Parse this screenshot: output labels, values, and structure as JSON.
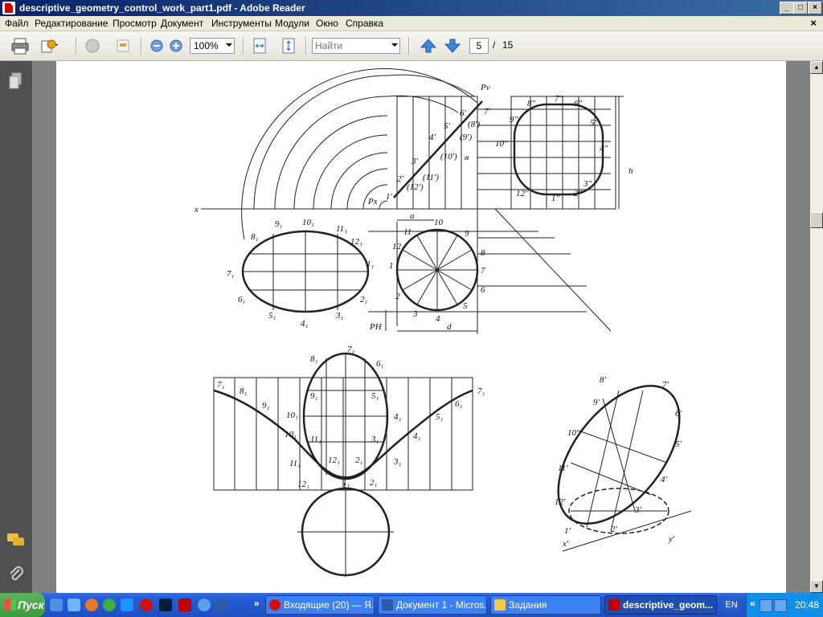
{
  "window": {
    "title": "descriptive_geometry_control_work_part1.pdf - Adobe Reader",
    "controls": {
      "minimize": "_",
      "maximize": "□",
      "close": "×"
    }
  },
  "menu": {
    "items": [
      "Файл",
      "Редактирование",
      "Просмотр",
      "Документ",
      "Инструменты",
      "Модули",
      "Окно",
      "Справка"
    ],
    "close_document": "×"
  },
  "toolbar": {
    "zoom_value": "100%",
    "find_placeholder": "Найти",
    "current_page": "5",
    "page_separator": "/",
    "total_pages": "15"
  },
  "drawing": {
    "top_labels": {
      "pv": "Pv",
      "px": "Px",
      "ph": "PH",
      "x": "x",
      "a": "a",
      "d": "d",
      "h": "h",
      "alpha": "∝",
      "front_points": [
        "1'",
        "2'",
        "3'",
        "4'",
        "5'",
        "6'",
        "7'",
        "(8')",
        "(9')",
        "(10')",
        "(11')",
        "(12')"
      ],
      "side_points": [
        "8''",
        "7''",
        "6''",
        "9''",
        "5''",
        "10''",
        "4''",
        "3''",
        "12''",
        "1''",
        "2''"
      ],
      "top_view_numbers": [
        "10",
        "11",
        "9",
        "12",
        "8",
        "1",
        "7",
        "2",
        "6",
        "3",
        "4",
        "5"
      ],
      "section_labels": [
        "10₁",
        "9₁",
        "11₁",
        "8₁",
        "12₁",
        "7₁",
        "1₁",
        "6₁",
        "2₁",
        "5₁",
        "4₁",
        "3₁"
      ]
    },
    "development_labels": [
      "7₁",
      "8₁",
      "9₁",
      "10₁",
      "11₁",
      "12₁",
      "1₁",
      "2₁",
      "3₁",
      "4₁",
      "5₁",
      "6₁",
      "7₁"
    ],
    "ellipse_labels": [
      "7₁",
      "8₁",
      "6₁",
      "9₁",
      "5₁",
      "10₁",
      "4₁",
      "11₁",
      "3₁",
      "12₁",
      "2₁",
      "1₁"
    ],
    "iso_labels": [
      "8'",
      "7'",
      "9'",
      "6'",
      "10'",
      "5'",
      "11'",
      "4'",
      "12'",
      "3'",
      "1'",
      "2'",
      "x'",
      "y'"
    ]
  },
  "taskbar": {
    "start_label": "Пуск",
    "tasks": [
      {
        "label": "Входящие (20) — Я...",
        "icon_color": "#d01010"
      },
      {
        "label": "Документ 1 - Micros...",
        "icon_color": "#2f5aa8"
      },
      {
        "label": "Задания",
        "icon_color": "#f3c94a"
      },
      {
        "label": "descriptive_geom...",
        "icon_color": "#c00000",
        "active": true
      }
    ],
    "language": "EN",
    "clock": "20:48",
    "more_arrows": "»",
    "tray_arrows": "«"
  },
  "colors": {
    "title_gradient_start": "#0a246a",
    "title_gradient_end": "#3a6ea5",
    "taskbar": "#245edb"
  }
}
